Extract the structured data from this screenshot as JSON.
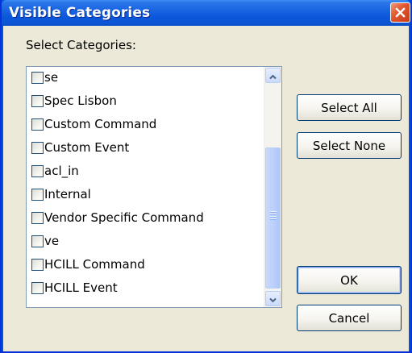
{
  "dialog": {
    "title": "Visible Categories",
    "prompt": "Select Categories:"
  },
  "categories": [
    {
      "label": "se",
      "checked": false
    },
    {
      "label": "Spec Lisbon",
      "checked": false
    },
    {
      "label": "Custom Command",
      "checked": false
    },
    {
      "label": "Custom Event",
      "checked": false
    },
    {
      "label": "acl_in",
      "checked": false
    },
    {
      "label": "Internal",
      "checked": false
    },
    {
      "label": "Vendor Specific Command",
      "checked": false
    },
    {
      "label": "ve",
      "checked": false
    },
    {
      "label": "HCILL Command",
      "checked": false
    },
    {
      "label": "HCILL Event",
      "checked": false
    }
  ],
  "buttons": {
    "select_all": "Select All",
    "select_none": "Select None",
    "ok": "OK",
    "cancel": "Cancel"
  },
  "colors": {
    "titlebar": "#0054e3",
    "dialog_background": "#ece9d8",
    "close_button": "#e2582f"
  },
  "icons": {
    "close": "close-icon",
    "scroll_up": "scroll-up-arrow-icon",
    "scroll_down": "scroll-down-arrow-icon"
  }
}
